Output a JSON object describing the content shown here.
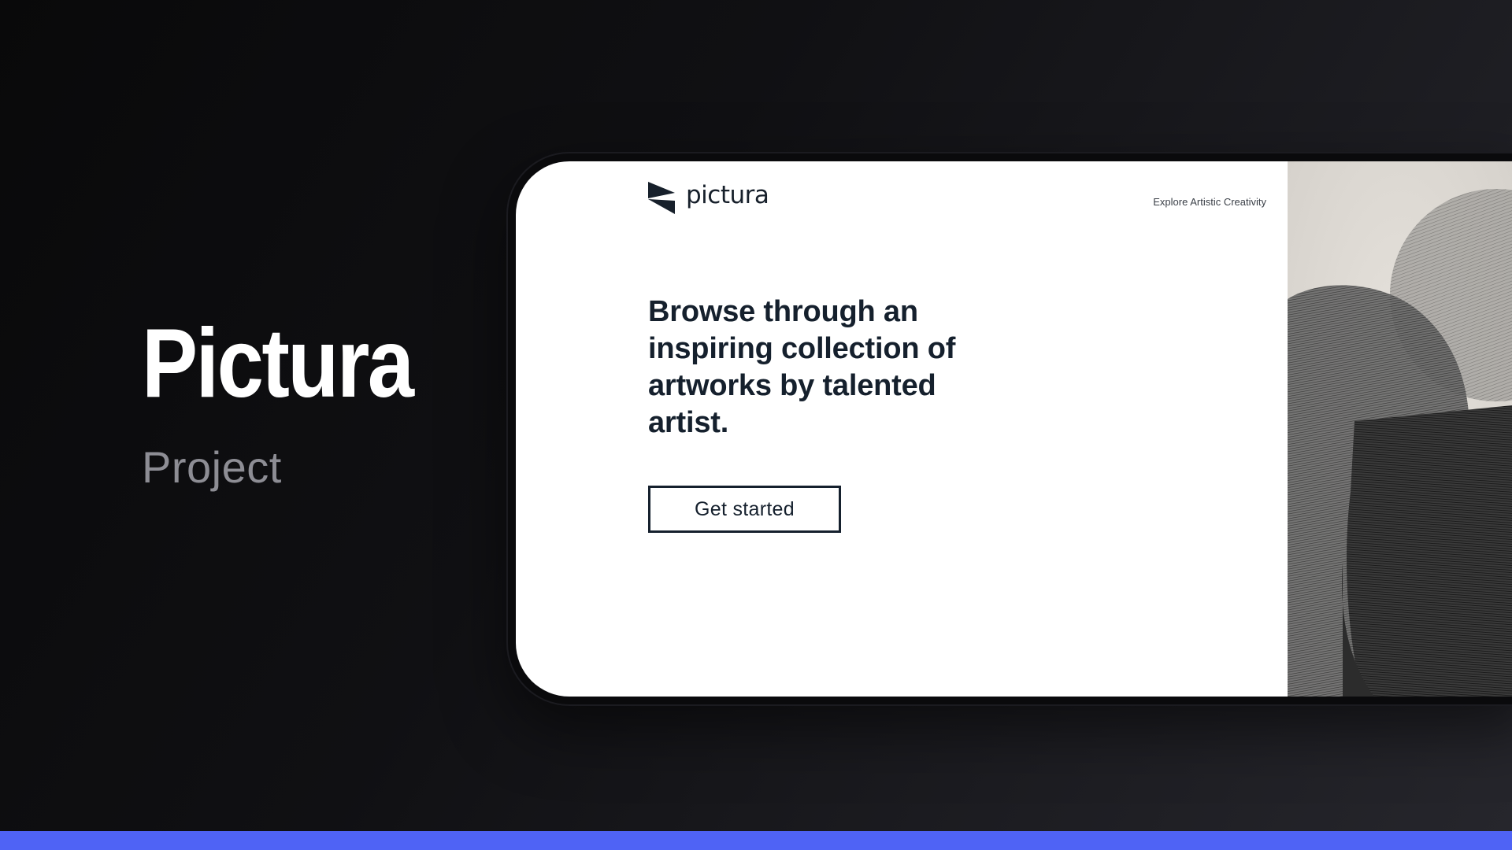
{
  "slide": {
    "title": "Pictura",
    "subtitle": "Project",
    "accent_color": "#4f63f5"
  },
  "site": {
    "brand": {
      "name": "pictura",
      "logo_icon": "bowtie-triangle-logo-icon"
    },
    "tagline": "Explore Artistic Creativity",
    "hero": {
      "heading": "Browse through an inspiring collection of artworks by talented artist.",
      "cta_label": "Get started"
    },
    "artwork": {
      "description_icon": "abstract-grayscale-artwork"
    },
    "colors": {
      "ink": "#15202d",
      "background": "#ffffff",
      "art_paper": "#dedad4"
    }
  }
}
